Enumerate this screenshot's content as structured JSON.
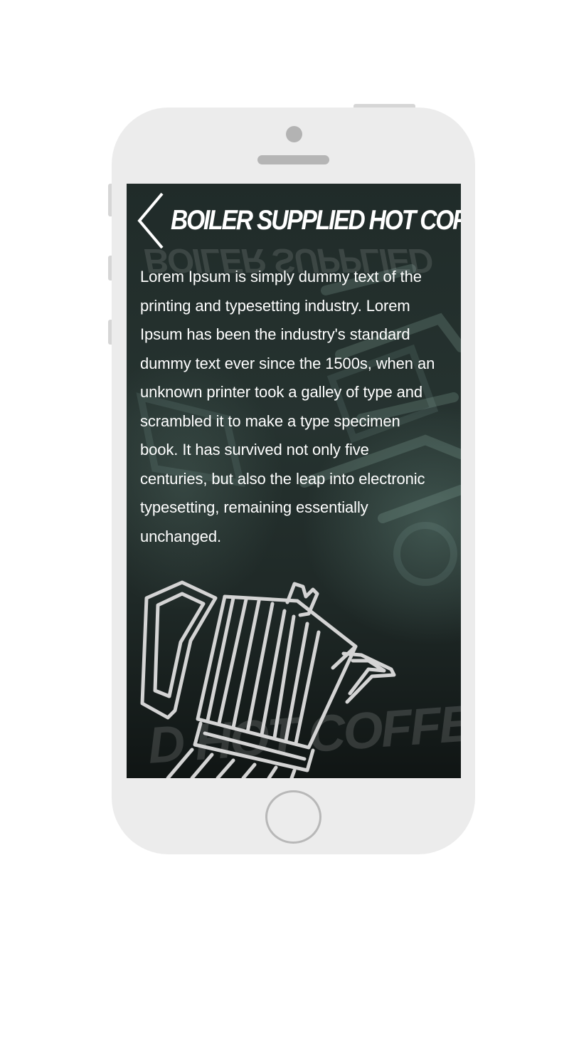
{
  "screen": {
    "title": "BOILER SUPPLIED HOT COFFEE",
    "body": "Lorem Ipsum is simply dummy text of the printing and typesetting industry. Lorem Ipsum has been the industry's standard dummy text ever since the 1500s, when an unknown printer took a galley of type and scrambled it to make a type specimen book. It has survived not only five centuries, but also the leap into electronic typesetting, remaining essentially unchanged.",
    "back_icon": "chevron-left-icon",
    "illustration": "moka-pot-icon"
  },
  "colors": {
    "phone_body": "#ececec",
    "screen_bg": "#222d2b",
    "text": "#ffffff",
    "outline": "#d0d0d0"
  }
}
